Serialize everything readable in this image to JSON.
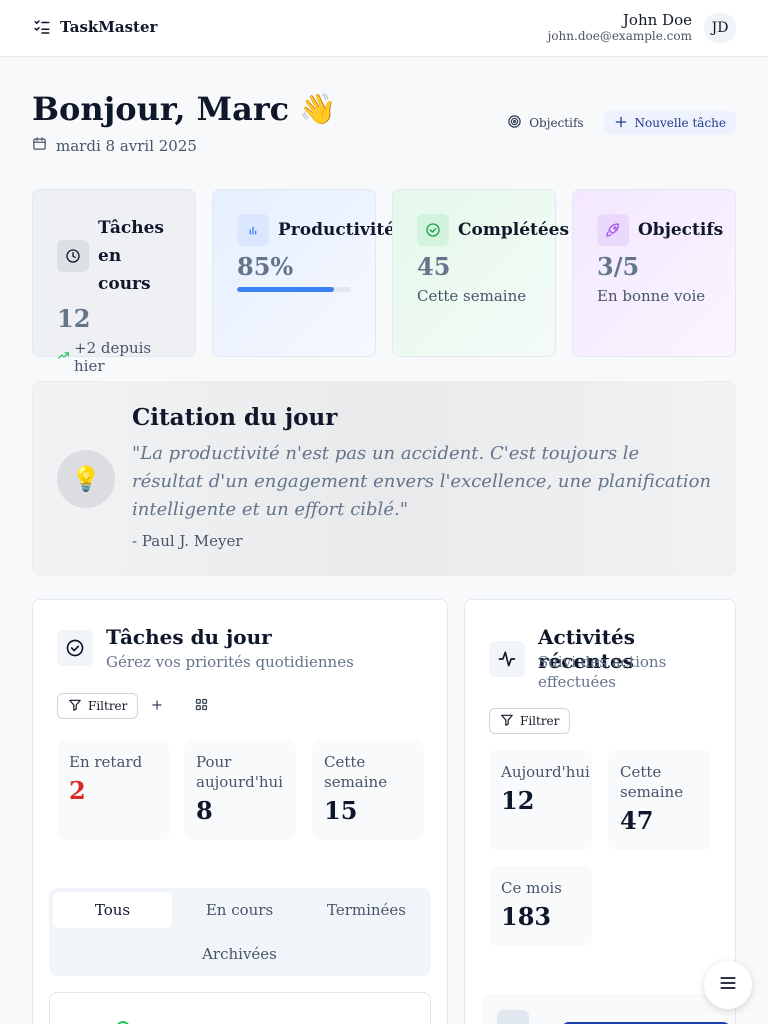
{
  "header": {
    "app_name": "TaskMaster",
    "user_name": "John Doe",
    "user_email": "john.doe@example.com",
    "avatar_initials": "JD"
  },
  "greeting": {
    "title": "Bonjour, Marc",
    "emoji": "👋",
    "date": "mardi 8 avril 2025"
  },
  "actions": {
    "objectives_label": "Objectifs",
    "new_task_label": "Nouvelle tâche"
  },
  "stats": [
    {
      "title": "Tâches en cours",
      "value": "12",
      "sub": "+2 depuis hier",
      "icon": "clock-icon"
    },
    {
      "title": "Productivité",
      "value": "85%",
      "progress": 0.85,
      "icon": "bar-chart-icon"
    },
    {
      "title": "Complétées",
      "value": "45",
      "sub": "Cette semaine",
      "icon": "check-circle-icon"
    },
    {
      "title": "Objectifs",
      "value": "3/5",
      "sub": "En bonne voie",
      "icon": "rocket-icon"
    }
  ],
  "quote": {
    "title": "Citation du jour",
    "text": "\"La productivité n'est pas un accident. C'est toujours le résultat d'un engagement envers l'excellence, une planification intelligente et un effort ciblé.\"",
    "author": "- Paul J. Meyer",
    "icon": "lightbulb-icon"
  },
  "tasks_panel": {
    "title": "Tâches du jour",
    "subtitle": "Gérez vos priorités quotidiennes",
    "filter_label": "Filtrer",
    "summary": [
      {
        "label": "En retard",
        "value": "2"
      },
      {
        "label": "Pour aujourd'hui",
        "value": "8"
      },
      {
        "label": "Cette semaine",
        "value": "15"
      }
    ],
    "tabs": [
      "Tous",
      "En cours",
      "Terminées",
      "Archivées"
    ],
    "active_tab": "Tous"
  },
  "activity_panel": {
    "title": "Activités récentes",
    "subtitle": "Suivi des actions effectuées",
    "filter_label": "Filtrer",
    "summary": [
      {
        "label": "Aujourd'hui",
        "value": "12"
      },
      {
        "label": "Cette semaine",
        "value": "47"
      },
      {
        "label": "Ce mois",
        "value": "183"
      }
    ]
  },
  "colors": {
    "accent": "#3b82f6",
    "danger": "#dc2626",
    "success": "#22c55e",
    "purple": "#a855f7"
  }
}
